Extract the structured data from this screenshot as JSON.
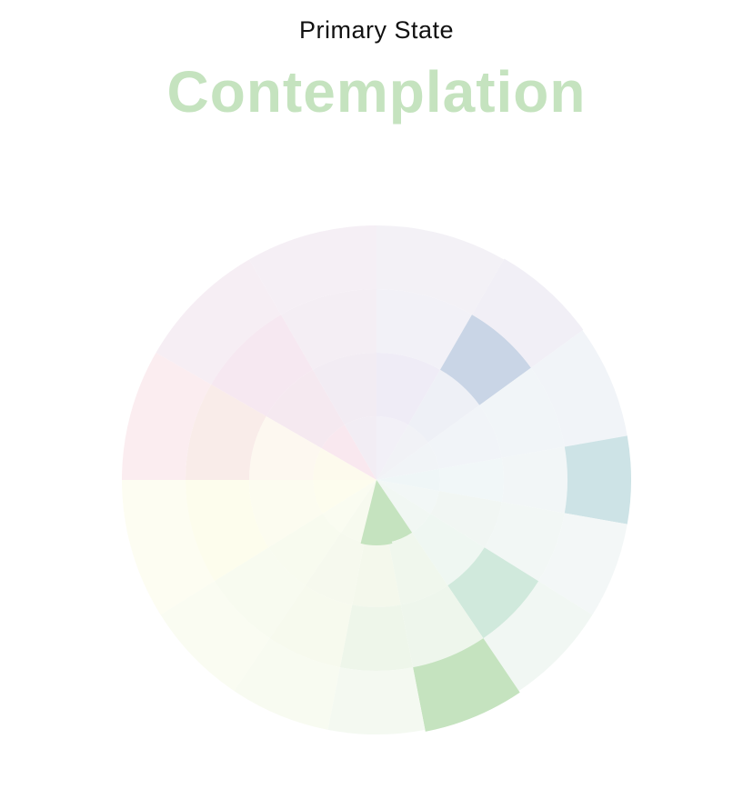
{
  "header": {
    "subtitle": "Primary State",
    "state_name": "Contemplation",
    "state_color": "#c5e3bf"
  },
  "wheel": {
    "sectors": [
      {
        "name": "pink",
        "rings": [
          "#f9e8ef",
          "#f5e9f0",
          "#f6e8f1",
          "#f6eef4"
        ]
      },
      {
        "name": "pink-lilac",
        "rings": [
          "#f2edf4",
          "#f2ecf3",
          "#f4eef4",
          "#f5eff5"
        ]
      },
      {
        "name": "lavender",
        "rings": [
          "#f2f0f7",
          "#efecf6",
          "#f2f1f7",
          "#f3f1f6"
        ]
      },
      {
        "name": "blue",
        "rings": [
          "#f1f2f6",
          "#eef0f6",
          "#c9d5e6",
          "#f1eff6"
        ]
      },
      {
        "name": "light-blue",
        "rings": [
          "#f1f4f7",
          "#f1f4f8",
          "#f1f5f8",
          "#f1f4f8"
        ]
      },
      {
        "name": "teal",
        "rings": [
          "#eff6f7",
          "#f1f7f8",
          "#f2f6f7",
          "#cde3e6"
        ]
      },
      {
        "name": "mint-blue",
        "rings": [
          "#f2f7f6",
          "#f1f6f3",
          "#f2f7f5",
          "#f3f7f7"
        ]
      },
      {
        "name": "mint",
        "rings": [
          "#f1f7f3",
          "#eff7f2",
          "#d0e9dc",
          "#f1f7f3"
        ]
      },
      {
        "name": "green",
        "rings": [
          "#c5e3bf",
          "#f0f7ed",
          "#eef6ec",
          "#c5e3bf"
        ]
      },
      {
        "name": "green-yellow",
        "rings": [
          "#f6f9ee",
          "#f4f8ec",
          "#eef6ea",
          "#f4f9f1"
        ]
      },
      {
        "name": "lime",
        "rings": [
          "#f7faef",
          "#f6f9ee",
          "#f7faee",
          "#f8fbf1"
        ]
      },
      {
        "name": "yellow-lime",
        "rings": [
          "#fafcf1",
          "#f8fbef",
          "#f8fbf0",
          "#fafcf2"
        ]
      },
      {
        "name": "yellow",
        "rings": [
          "#fdfdee",
          "#fcfcf0",
          "#fdfded",
          "#fdfdf2"
        ]
      },
      {
        "name": "cream",
        "rings": [
          "#fdfaed",
          "#fdf8f0",
          "#f9ece9",
          "#fbedf0"
        ]
      }
    ]
  }
}
